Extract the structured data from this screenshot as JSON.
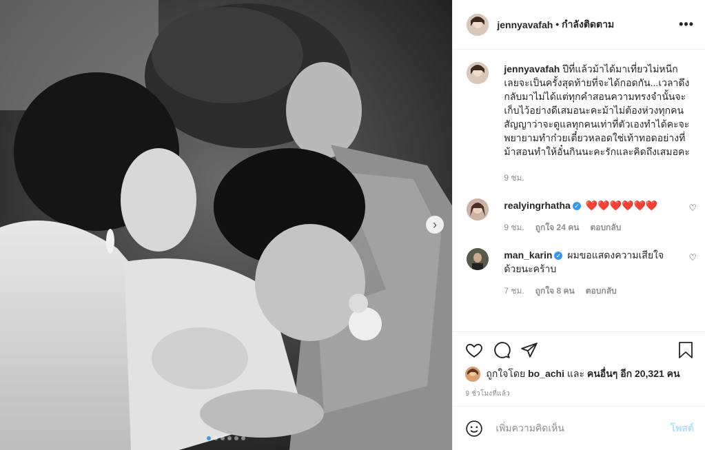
{
  "post": {
    "username": "jennyavafah",
    "follow_status": "• กำลังติดตาม",
    "more_icon": "more-horizontal-icon",
    "caption_text": "ปีที่แล้วม้าได้มาเที่ยวไม่หนีก เลยจะเป็นครั้งสุดท้ายที่จะได้กอดกัน...เวลาดึงกลับมาไม่ได้แต่ทุกคำสอนความทรงจำนั้นจะเก็บไว้อย่างดีเสมอนะคะม้าไม่ต้องห่วงทุกคนสัญญาว่าจะดูแลทุกคนเท่าที่ตัวเองทำได้คะจะพยายามทำก๋วยเตี๋ยวหลอดใช่เท้าทอดอย่างที่ม้าสอนทำให้อั๋นกินนะคะรักและคิดถึงเสมอคะ",
    "caption_time": "9 ชม."
  },
  "comments": [
    {
      "username": "realyingrhatha",
      "text": "❤️❤️❤️❤️❤️❤️",
      "time": "9 ชม.",
      "likes": "ถูกใจ 24 คน",
      "reply": "ตอบกลับ"
    },
    {
      "username": "man_karin",
      "text": "ผมขอแสดงความเสียใจด้วยนะคร้าบ",
      "time": "7 ชม.",
      "likes": "ถูกใจ 8 คน",
      "reply": "ตอบกลับ"
    }
  ],
  "actions": {
    "like_icon": "heart-icon",
    "comment_icon": "comment-icon",
    "share_icon": "share-icon",
    "save_icon": "bookmark-icon",
    "liked_by_prefix": "ถูกใจโดย",
    "liked_by_user": "bo_achi",
    "liked_by_and": "และ",
    "liked_by_others": "คนอื่นๆ อีก 20,321 คน",
    "time_ago": "9 ชั่วโมงที่แล้ว"
  },
  "add_comment": {
    "placeholder": "เพิ่มความคิดเห็น",
    "post_label": "โพสต์",
    "emoji_icon": "emoji-icon"
  },
  "carousel": {
    "next_icon": "chevron-right-icon",
    "slide_count": 6,
    "active_index": 0
  },
  "colors": {
    "accent": "#3897f0",
    "heart_red": "#ed4956",
    "muted": "#8e8e8e"
  }
}
